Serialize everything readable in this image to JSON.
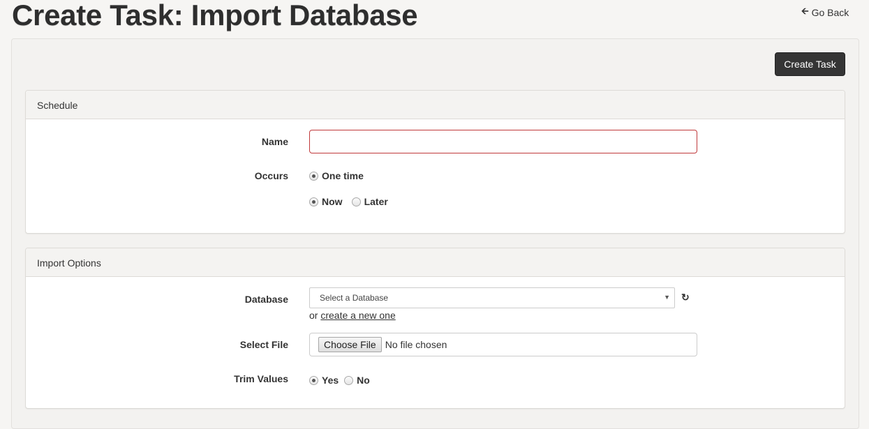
{
  "header": {
    "title": "Create Task: Import Database",
    "go_back_label": "Go Back",
    "go_back_icon": "arrow-left-icon"
  },
  "toolbar": {
    "create_task_label": "Create Task"
  },
  "schedule": {
    "heading": "Schedule",
    "name_label": "Name",
    "name_value": "",
    "occurs_label": "Occurs",
    "occurs_options": [
      {
        "label": "One time",
        "checked": true
      }
    ],
    "when_options": [
      {
        "label": "Now",
        "checked": true
      },
      {
        "label": "Later",
        "checked": false
      }
    ]
  },
  "import_options": {
    "heading": "Import Options",
    "database_label": "Database",
    "database_selected": "Select a Database",
    "refresh_icon": "refresh-icon",
    "helper_prefix": "or",
    "helper_link": "create a new one",
    "select_file_label": "Select File",
    "choose_file_label": "Choose File",
    "file_status": "No file chosen",
    "trim_values_label": "Trim Values",
    "trim_options": [
      {
        "label": "Yes",
        "checked": true
      },
      {
        "label": "No",
        "checked": false
      }
    ]
  },
  "colors": {
    "error_border": "#c0393b",
    "primary_button": "#353535"
  }
}
